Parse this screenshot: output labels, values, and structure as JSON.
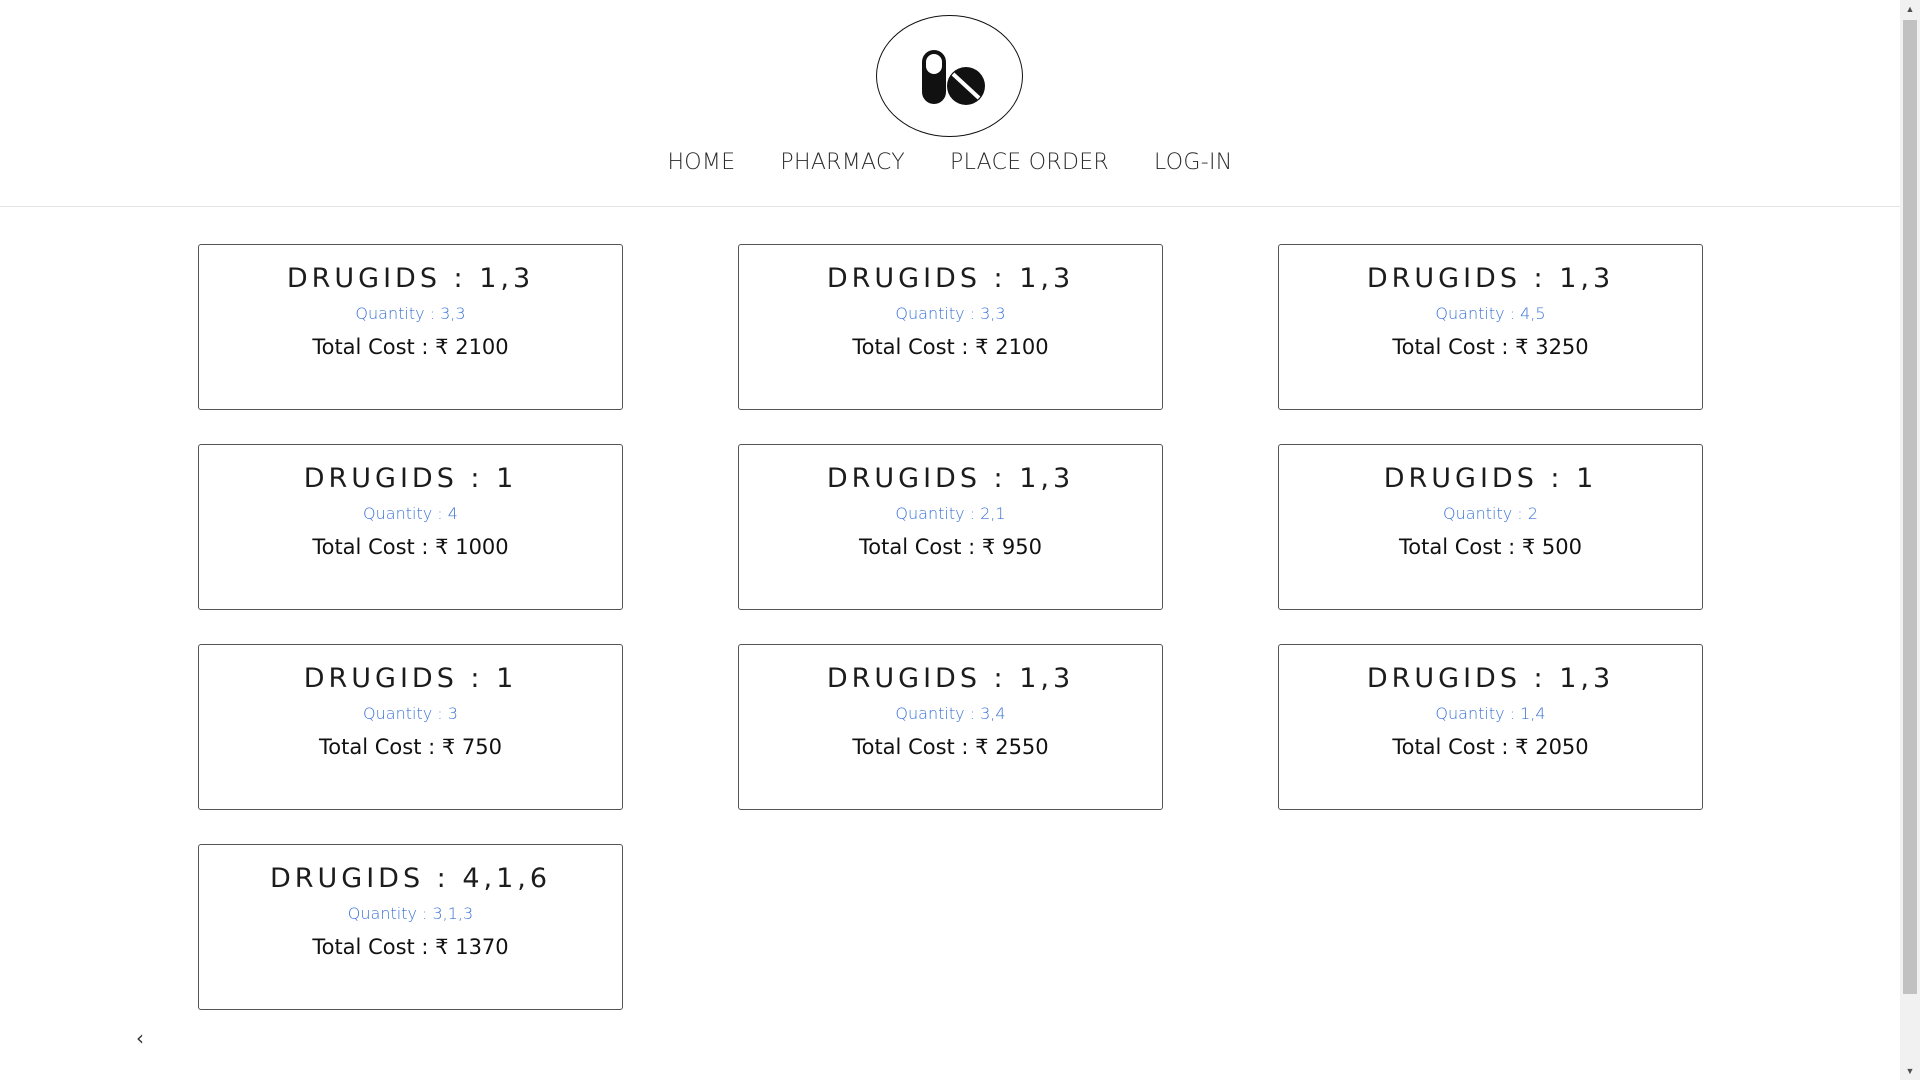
{
  "header": {
    "logo_icon": "pills-icon",
    "nav": [
      {
        "label": "HOME"
      },
      {
        "label": "PHARMACY"
      },
      {
        "label": "PLACE ORDER"
      },
      {
        "label": "LOG-IN"
      }
    ]
  },
  "orders": [
    {
      "title": "DRUGIDS : 1,3",
      "quantity": "Quantity : 3,3",
      "cost": "Total Cost : ₹ 2100"
    },
    {
      "title": "DRUGIDS : 1,3",
      "quantity": "Quantity : 3,3",
      "cost": "Total Cost : ₹ 2100"
    },
    {
      "title": "DRUGIDS : 1,3",
      "quantity": "Quantity : 4,5",
      "cost": "Total Cost : ₹ 3250"
    },
    {
      "title": "DRUGIDS : 1",
      "quantity": "Quantity : 4",
      "cost": "Total Cost : ₹ 1000"
    },
    {
      "title": "DRUGIDS : 1,3",
      "quantity": "Quantity : 2,1",
      "cost": "Total Cost : ₹ 950"
    },
    {
      "title": "DRUGIDS : 1",
      "quantity": "Quantity : 2",
      "cost": "Total Cost : ₹ 500"
    },
    {
      "title": "DRUGIDS : 1",
      "quantity": "Quantity : 3",
      "cost": "Total Cost : ₹ 750"
    },
    {
      "title": "DRUGIDS : 1,3",
      "quantity": "Quantity : 3,4",
      "cost": "Total Cost : ₹ 2550"
    },
    {
      "title": "DRUGIDS : 1,3",
      "quantity": "Quantity : 1,4",
      "cost": "Total Cost : ₹ 2050"
    },
    {
      "title": "DRUGIDS : 4,1,6",
      "quantity": "Quantity : 3,1,3",
      "cost": "Total Cost : ₹ 1370"
    }
  ],
  "footer": {
    "back_label": "‹",
    "back_icon": "chevron-left-icon"
  },
  "colors": {
    "quantity_text": "#3b73d6",
    "card_border": "#555555",
    "scroll_thumb": "#c1c1c1"
  }
}
